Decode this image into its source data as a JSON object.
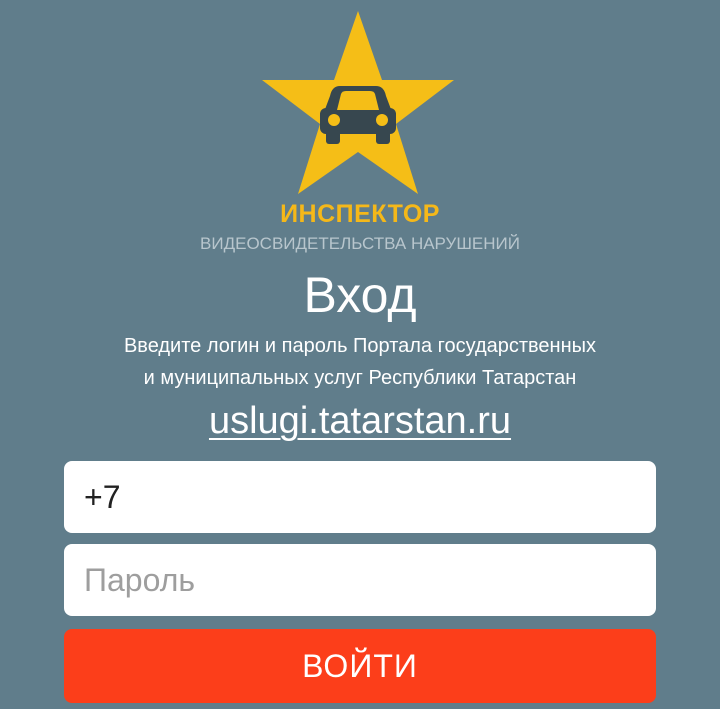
{
  "app": {
    "title": "ИНСПЕКТОР",
    "subtitle": "ВИДЕОСВИДЕТЕЛЬСТВА НАРУШЕНИЙ",
    "logo_icon": "star-car-icon",
    "brand_color": "#f5b819"
  },
  "login": {
    "heading": "Вход",
    "description_line1": "Введите логин и пароль Портала государственных",
    "description_line2": "и муниципальных услуг Республики Татарстан",
    "portal_link": "uslugi.tatarstan.ru",
    "phone_value": "+7",
    "password_placeholder": "Пароль",
    "submit_label": "ВОЙТИ",
    "submit_color": "#fc3e1a"
  },
  "colors": {
    "background": "#607d8b",
    "field_background": "#ffffff"
  }
}
